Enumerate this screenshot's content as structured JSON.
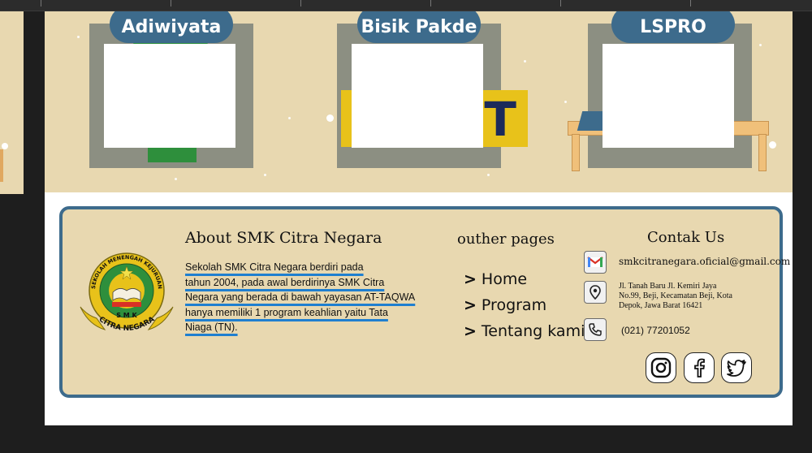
{
  "hero": {
    "cards": [
      {
        "label": "Adiwiyata"
      },
      {
        "label": "Bisik Pakde"
      },
      {
        "label": "LSPRO"
      }
    ],
    "badge_text": "ST"
  },
  "logo": {
    "ring_text": "SEKOLAH MENENGAH KEJURUAN",
    "center_text": "S M K",
    "bottom_text": "CITRA NEGARA"
  },
  "about": {
    "title": "About SMK Citra Negara",
    "lines": [
      "Sekolah SMK Citra Negara berdiri pada",
      "tahun 2004, pada awal berdirinya SMK Citra",
      "Negara yang berada di bawah yayasan AT-TAQWA",
      "hanya memiliki 1 program keahlian yaitu Tata",
      "Niaga (TN)."
    ]
  },
  "pages": {
    "title": "outher pages",
    "chevron": ">",
    "items": [
      {
        "label": "Home"
      },
      {
        "label": "Program"
      },
      {
        "label": "Tentang kami"
      }
    ]
  },
  "contact": {
    "title": "Contak Us",
    "email": "smkcitranegara.oficial@gmail.com",
    "address_lines": [
      "Jl. Tanah Baru Jl. Kemiri Jaya",
      "No.99, Beji, Kecamatan Beji, Kota",
      "Depok, Jawa Barat 16421"
    ],
    "phone": "(021) 77201052"
  },
  "colors": {
    "accent": "#3d6b8c",
    "background": "#e8d8b0",
    "underline": "#1f7fd0",
    "gmail_red": "#d93025"
  },
  "icons": {
    "email": "gmail-icon",
    "address": "location-pin-icon",
    "phone": "phone-icon",
    "social": [
      "instagram-icon",
      "facebook-icon",
      "twitter-icon"
    ]
  }
}
